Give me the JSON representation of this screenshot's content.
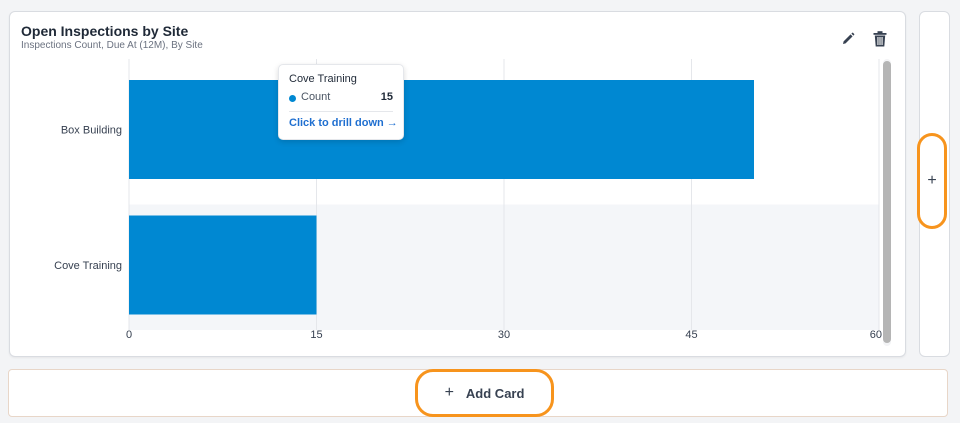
{
  "card": {
    "title": "Open Inspections by Site",
    "subtitle": "Inspections Count, Due At (12M), By Site",
    "edit_icon": "pencil-icon",
    "delete_icon": "trash-icon"
  },
  "chart_data": {
    "type": "bar",
    "orientation": "horizontal",
    "categories": [
      "Box Building",
      "Cove Training"
    ],
    "series": [
      {
        "name": "Count",
        "values": [
          50,
          15
        ]
      }
    ],
    "x_ticks": [
      "0",
      "15",
      "30",
      "45",
      "60"
    ],
    "xlim": [
      0,
      60
    ],
    "grid": true,
    "bar_color": "#0088d2",
    "highlighted_category": "Cove Training"
  },
  "tooltip": {
    "title": "Cove Training",
    "label": "Count",
    "value": "15",
    "link": "Click to drill down →"
  },
  "side_panel": {
    "add_label": "+"
  },
  "add_card": {
    "plus": "+",
    "label": "Add Card"
  },
  "colors": {
    "accent_highlight": "#f7941d",
    "bar": "#0088d2",
    "link": "#1f6fd0"
  }
}
